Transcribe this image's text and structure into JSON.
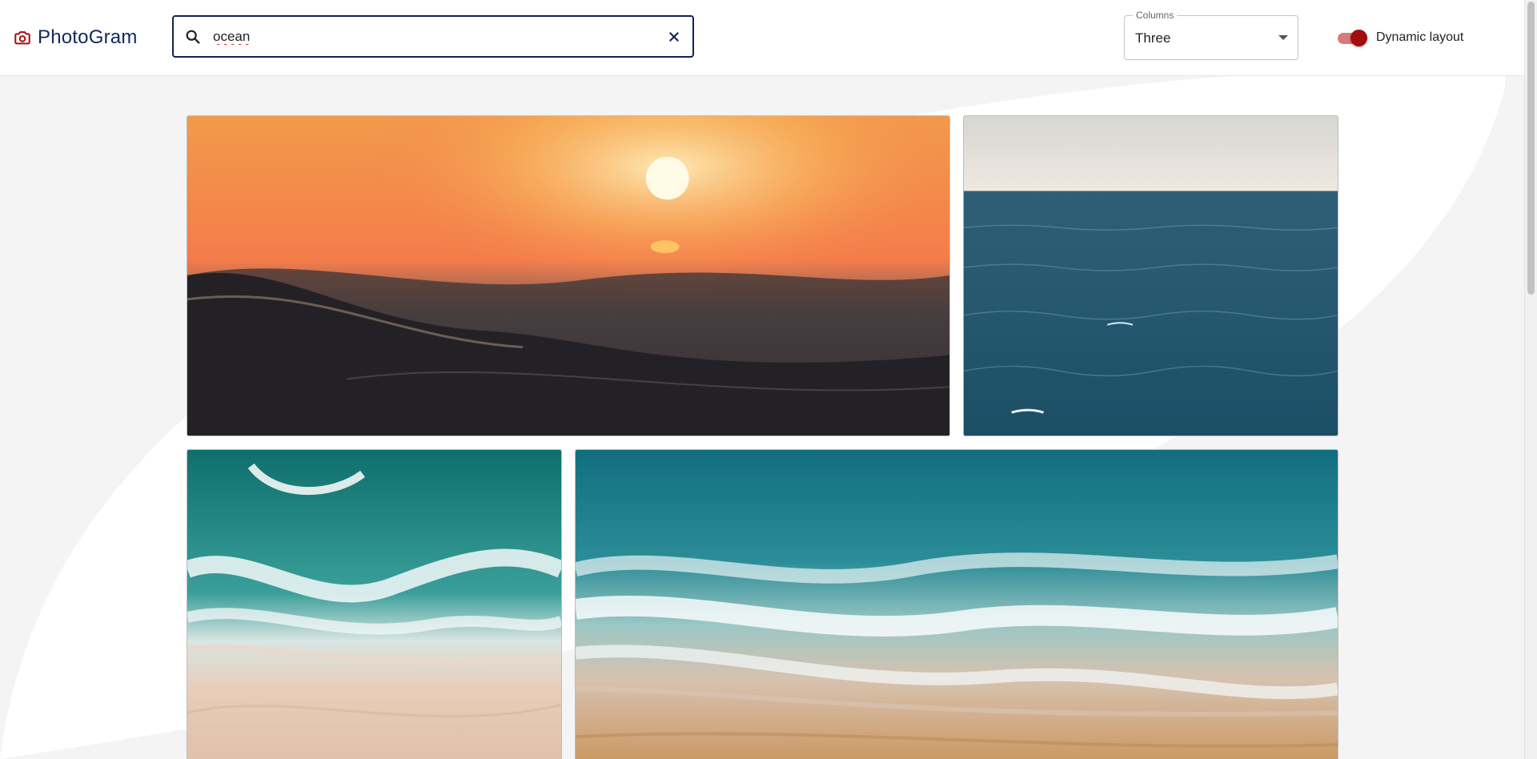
{
  "app": {
    "brand_name": "PhotoGram",
    "brand_icon": "camera-icon",
    "brand_color": "#102a5c",
    "accent_color": "#a30d0d"
  },
  "search": {
    "value": "ocean",
    "search_icon": "search-icon",
    "clear_icon": "close-icon"
  },
  "columns": {
    "label": "Columns",
    "selected": "Three"
  },
  "layout_toggle": {
    "label": "Dynamic layout",
    "enabled": true
  },
  "gallery": {
    "photos": [
      {
        "subject": "sunset-over-waves"
      },
      {
        "subject": "open-sea"
      },
      {
        "subject": "aerial-surf-beach"
      },
      {
        "subject": "aerial-shoreline-waves"
      }
    ]
  }
}
